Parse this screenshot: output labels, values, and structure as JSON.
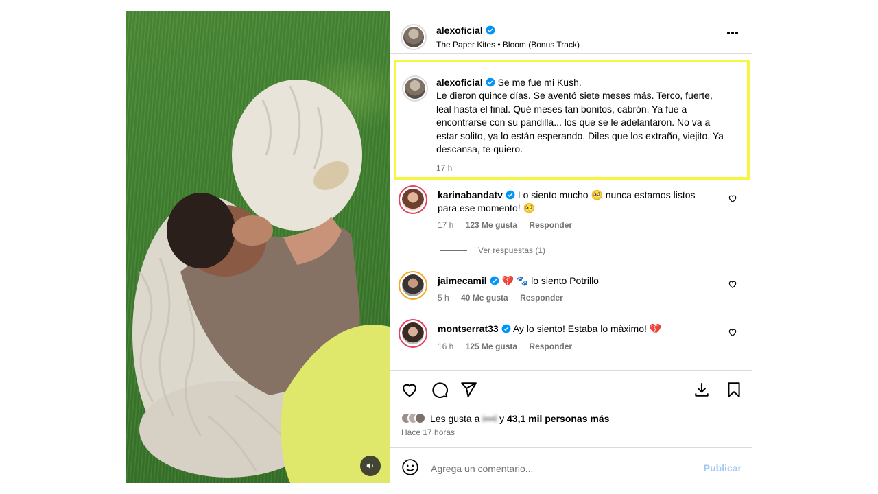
{
  "post": {
    "author": "alexoficial",
    "audio": "The Paper Kites • Bloom (Bonus Track)",
    "caption_lead": "Se me fue mi Kush.",
    "caption_body": "Le dieron quince días. Se aventó siete meses más. Terco, fuerte, leal hasta el final. Qué meses tan bonitos, cabrón. Ya fue a encontrarse con su pandilla... los que se le adelantaron. No va a estar solito, ya lo están esperando. Diles que los extraño, viejito. Ya descansa, te quiero.",
    "caption_time": "17 h"
  },
  "comments": [
    {
      "user": "karinabandatv",
      "text": "Lo siento mucho 🥺 nunca estamos listos para ese momento! 🥺",
      "time": "17 h",
      "likes": "123 Me gusta",
      "reply": "Responder"
    },
    {
      "user": "jaimecamil",
      "text": "💔 🐾 lo siento Potrillo",
      "time": "5 h",
      "likes": "40 Me gusta",
      "reply": "Responder"
    },
    {
      "user": "montserrat33",
      "text": "Ay lo siento! Estaba lo màximo! 💔",
      "time": "16 h",
      "likes": "125 Me gusta",
      "reply": "Responder"
    }
  ],
  "view_replies": "Ver respuestas (1)",
  "likes": {
    "prefix": "Les gusta a",
    "blurred_user": "i•••l",
    "suffix": "y",
    "count": "43,1 mil personas más"
  },
  "posted": "Hace 17 horas",
  "add_comment": {
    "placeholder": "Agrega un comentario...",
    "publish": "Publicar"
  },
  "colors": {
    "verified": "#0095f6",
    "highlight": "#f5f542",
    "publish_disabled": "#a5c8f3",
    "story_ring": "#e4405f"
  }
}
